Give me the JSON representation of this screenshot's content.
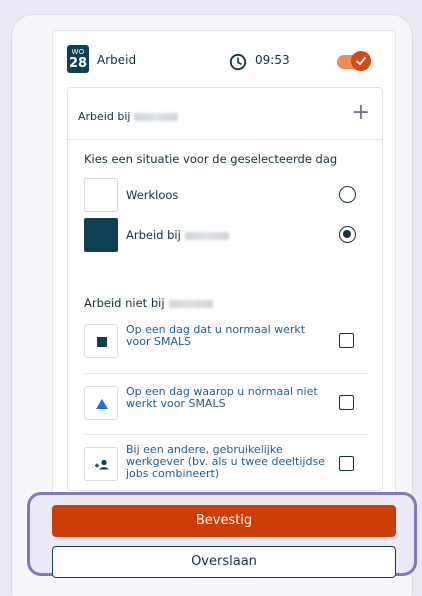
{
  "header": {
    "dow": "WO",
    "day": "28",
    "title": "Arbeid",
    "time": "09:53",
    "toggle_on": true
  },
  "section": {
    "title": "Arbeid bij",
    "question": "Kies een situatie voor de geselecteerde dag"
  },
  "radio_options": [
    {
      "label": "Werkloos",
      "selected": false
    },
    {
      "label": "Arbeid bij",
      "selected": true
    }
  ],
  "other_section": {
    "title": "Arbeid niet bij"
  },
  "check_options": [
    {
      "label": "Op een dag dat u normaal werkt voor SMALS",
      "icon": "square-icon",
      "checked": false
    },
    {
      "label": "Op een dag waarop u normaal niet werkt voor SMALS",
      "icon": "triangle-icon",
      "checked": false
    },
    {
      "label": "Bij een andere, gebruikelijke werkgever (bv. als u twee deeltijdse jobs combineert)",
      "icon": "add-person-icon",
      "checked": false
    }
  ],
  "buttons": {
    "confirm": "Bevestig",
    "skip": "Overslaan"
  },
  "colors": {
    "accent": "#cc3e06",
    "primary": "#0f4051",
    "highlight": "#8378b8"
  }
}
